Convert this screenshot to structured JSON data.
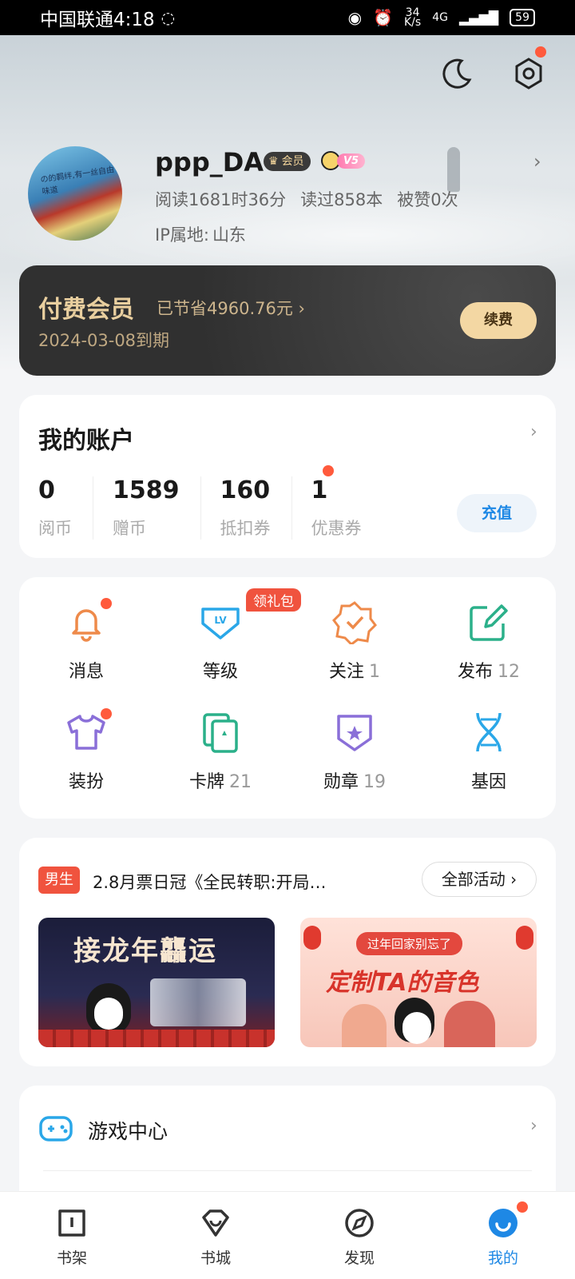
{
  "status_bar": {
    "carrier_time": "中国联通4:18",
    "speed": "34\nK/s",
    "network": "4G",
    "battery": "59"
  },
  "profile": {
    "username": "ppp_DA",
    "vip_badge": "会员",
    "level_badge": "V5",
    "reading_time": "阅读1681时36分",
    "books_read": "读过858本",
    "likes": "被赞0次",
    "ip_label": "IP属地:",
    "ip_value": "山东",
    "avatar_text": "の的羁绊,有一丝自由味道"
  },
  "vip_card": {
    "title": "付费会员",
    "saved": "已节省4960.76元 ›",
    "expire": "2024-03-08到期",
    "renew_label": "续费"
  },
  "account": {
    "title": "我的账户",
    "items": [
      {
        "value": "0",
        "label": "阅币"
      },
      {
        "value": "1589",
        "label": "赠币"
      },
      {
        "value": "160",
        "label": "抵扣券"
      },
      {
        "value": "1",
        "label": "优惠券"
      }
    ],
    "recharge_label": "充值"
  },
  "features": {
    "gift_tag": "领礼包",
    "items": [
      {
        "label": "消息",
        "count": ""
      },
      {
        "label": "等级",
        "count": ""
      },
      {
        "label": "关注",
        "count": "1"
      },
      {
        "label": "发布",
        "count": "12"
      },
      {
        "label": "装扮",
        "count": ""
      },
      {
        "label": "卡牌",
        "count": "21"
      },
      {
        "label": "勋章",
        "count": "19"
      },
      {
        "label": "基因",
        "count": ""
      }
    ]
  },
  "activity": {
    "tag": "男生",
    "text": "2.8月票日冠《全民转职:开局…",
    "all_label": "全部活动 ›",
    "banner1_title": "接龙年龘运",
    "banner2_sub": "过年回家别忘了",
    "banner2_title": "定制TA的音色"
  },
  "game": {
    "label": "游戏中心"
  },
  "nav": [
    {
      "label": "书架"
    },
    {
      "label": "书城"
    },
    {
      "label": "发现"
    },
    {
      "label": "我的"
    }
  ],
  "colors": {
    "accent": "#1e88e5",
    "badge_red": "#ff5a3c",
    "vip_gold": "#e9cf9f"
  }
}
